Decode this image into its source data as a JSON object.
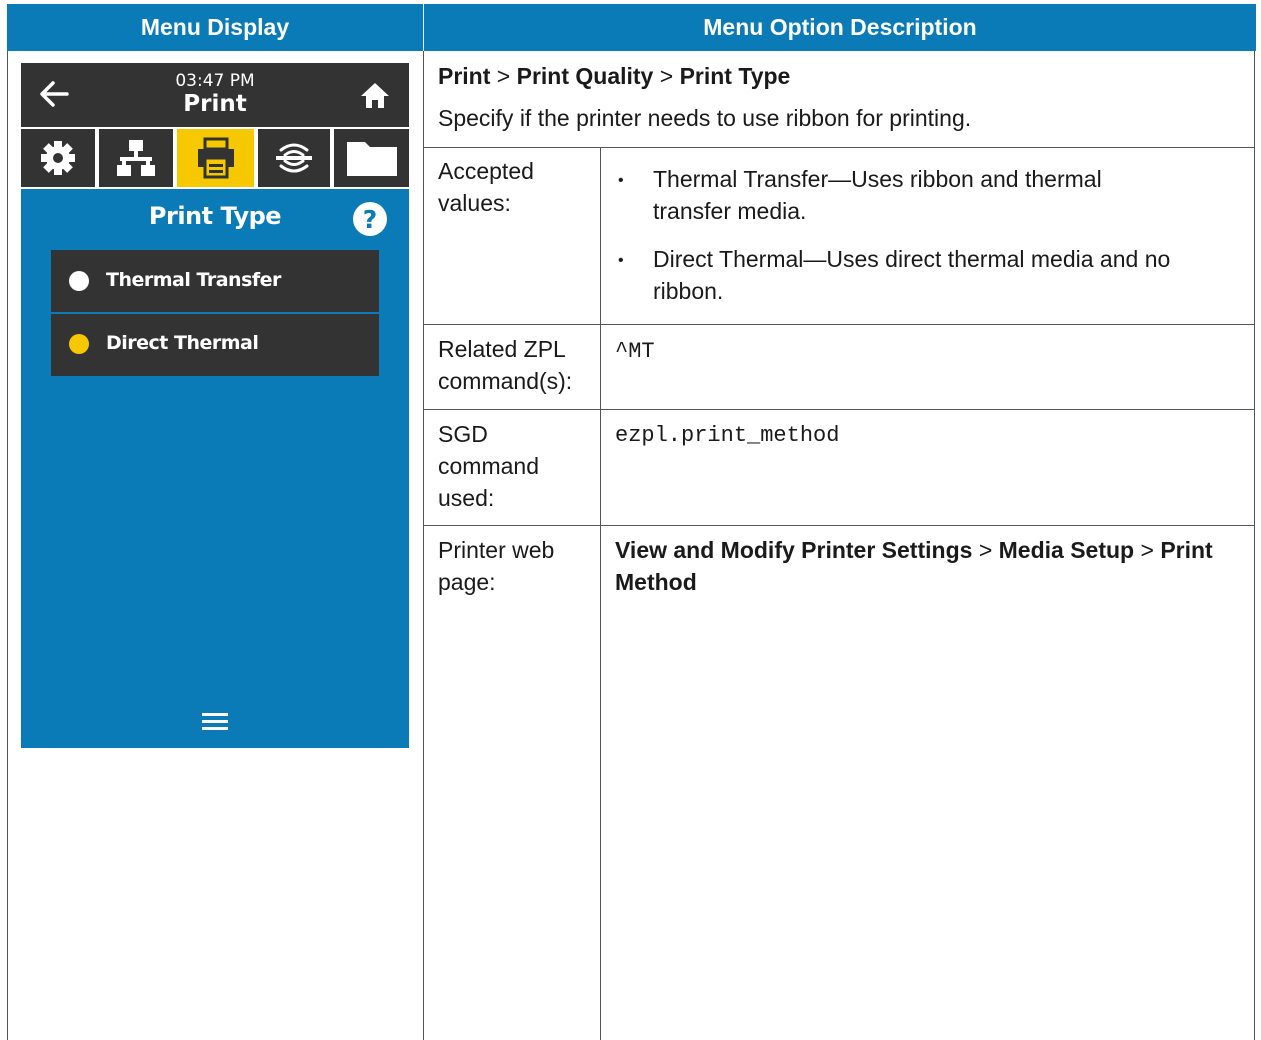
{
  "header": {
    "col1": "Menu Display",
    "col2": "Menu Option Description"
  },
  "screen": {
    "time": "03:47 PM",
    "title": "Print",
    "icons": [
      "back-arrow-icon",
      "home-icon",
      "gear-icon",
      "network-icon",
      "printer-icon",
      "wireless-icon",
      "folder-icon",
      "help-icon",
      "menu-icon"
    ],
    "active_tab": "printer",
    "page_title": "Print Type",
    "options": [
      {
        "label": "Thermal Transfer",
        "selected": false
      },
      {
        "label": "Direct Thermal",
        "selected": true
      }
    ],
    "colors": {
      "screen_bg": "#0a7bb6",
      "bar": "#333333",
      "accent": "#f6c800",
      "header": "#0a7bb6"
    }
  },
  "description": {
    "path": {
      "p1": "Print",
      "sep1": ">",
      "p2": "Print Quality",
      "sep2": ">",
      "p3": "Print Type"
    },
    "summary": "Specify if the printer needs to use ribbon for printing.",
    "accepted_label_1": "Accepted",
    "accepted_label_2": "values:",
    "values": [
      {
        "line1": "Thermal Transfer—Uses ribbon and thermal",
        "line2": "transfer media."
      },
      {
        "line1": "Direct Thermal—Uses direct thermal media and no",
        "line2": "ribbon."
      }
    ],
    "zpl_label_1": "Related ZPL",
    "zpl_label_2": "command(s):",
    "zpl_value": "^MT",
    "sgd_label_1": "SGD",
    "sgd_label_2": "command",
    "sgd_label_3": "used:",
    "sgd_value": "ezpl.print_method",
    "web_label_1": "Printer web",
    "web_label_2": "page:",
    "web_b1": "View and Modify Printer Settings",
    "web_sep1": ">",
    "web_b2": "Media Setup",
    "web_sep2": ">",
    "web_b3": "Print Method"
  }
}
